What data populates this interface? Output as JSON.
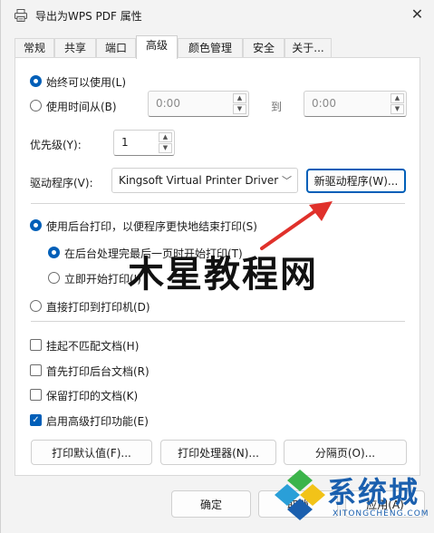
{
  "window": {
    "title": "导出为WPS PDF 属性",
    "close_glyph": "✕"
  },
  "tabs": [
    "常规",
    "共享",
    "端口",
    "高级",
    "颜色管理",
    "安全",
    "关于..."
  ],
  "active_tab": "高级",
  "availability": {
    "always_label": "始终可以使用(L)",
    "from_label": "使用时间从(B)",
    "from_time": "0:00",
    "to_label": "到",
    "to_time": "0:00",
    "selected": "always"
  },
  "priority": {
    "label": "优先级(Y):",
    "value": "1"
  },
  "driver": {
    "label": "驱动程序(V):",
    "selected": "Kingsoft Virtual Printer Driver",
    "new_driver_button": "新驱动程序(W)..."
  },
  "spool": {
    "spool_label": "使用后台打印，以便程序更快地结束打印(S)",
    "after_last_page_label": "在后台处理完最后一页时开始打印(T)",
    "immediately_label": "立即开始打印(I)",
    "direct_label": "直接打印到打印机(D)"
  },
  "options": [
    {
      "label": "挂起不匹配文档(H)",
      "checked": false
    },
    {
      "label": "首先打印后台文档(R)",
      "checked": false
    },
    {
      "label": "保留打印的文档(K)",
      "checked": false
    },
    {
      "label": "启用高级打印功能(E)",
      "checked": true
    }
  ],
  "buttons": {
    "defaults": "打印默认值(F)...",
    "processor": "打印处理器(N)...",
    "separator_page": "分隔页(O)...",
    "ok": "确定",
    "cancel": "取消",
    "apply": "应用(A)"
  },
  "watermarks": {
    "overlay_text": "木星教程网",
    "brand": "系统城",
    "url": "XITONGCHENG.COM"
  },
  "colors": {
    "accent": "#005fb8",
    "arrow": "#e0312b",
    "brand_blue": "#1a5fae",
    "brand_green": "#3cb44b"
  },
  "icons": {
    "title": "printer-icon",
    "close": "close-icon"
  }
}
